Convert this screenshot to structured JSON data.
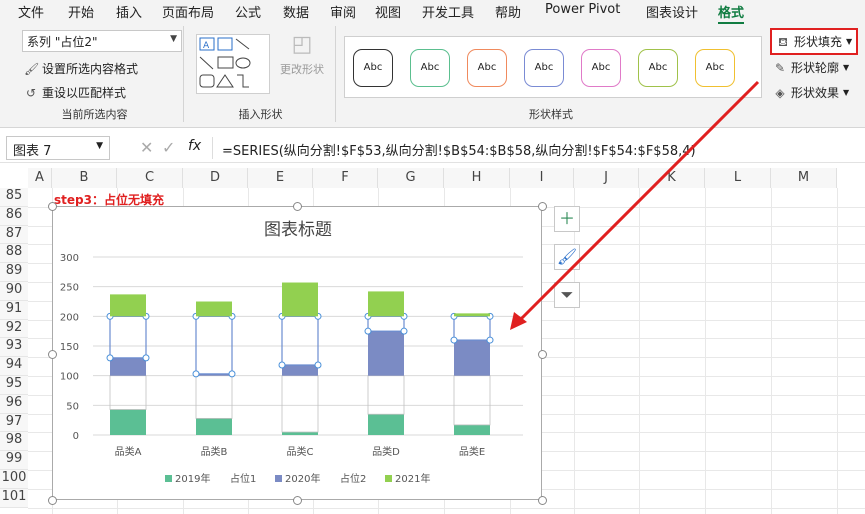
{
  "tabs": [
    "文件",
    "开始",
    "插入",
    "页面布局",
    "公式",
    "数据",
    "审阅",
    "视图",
    "开发工具",
    "帮助",
    "Power Pivot",
    "图表设计",
    "格式"
  ],
  "ribbon": {
    "current_selection": {
      "dropdown": "系列 \"占位2\"",
      "format_selection": "设置所选内容格式",
      "reset_style": "重设以匹配样式",
      "label": "当前所选内容"
    },
    "insert_shapes": {
      "change_shape": "更改形状",
      "label": "插入形状"
    },
    "shape_styles": {
      "abc": [
        "Abc",
        "Abc",
        "Abc",
        "Abc",
        "Abc",
        "Abc",
        "Abc"
      ],
      "colors": [
        "#333333",
        "#5bbf8f",
        "#f08a5d",
        "#7a8bd4",
        "#e07ac8",
        "#a0c24a",
        "#f0c030"
      ],
      "label": "形状样式"
    },
    "shape_fill": "形状填充",
    "shape_outline": "形状轮廓",
    "shape_effects": "形状效果"
  },
  "formula_bar": {
    "name_box": "图表 7",
    "fx": "fx",
    "formula": "=SERIES(纵向分割!$F$53,纵向分割!$B$54:$B$58,纵向分割!$F$54:$F$58,4)"
  },
  "columns": [
    "A",
    "B",
    "C",
    "D",
    "E",
    "F",
    "G",
    "H",
    "I",
    "J",
    "K",
    "L",
    "M"
  ],
  "rows": [
    "85",
    "86",
    "87",
    "88",
    "89",
    "90",
    "91",
    "92",
    "93",
    "94",
    "95",
    "96",
    "97",
    "98",
    "99",
    "100",
    "101"
  ],
  "step_note": "step3：占位无填充",
  "chart_data": {
    "type": "bar",
    "title": "图表标题",
    "categories": [
      "品类A",
      "品类B",
      "品类C",
      "品类D",
      "品类E"
    ],
    "ylim": [
      0,
      300
    ],
    "yticks": [
      "0",
      "50",
      "100",
      "150",
      "200",
      "250",
      "300"
    ],
    "series": [
      {
        "name": "2019年",
        "color": "#5bbf94",
        "values": [
          43,
          28,
          5,
          35,
          17
        ]
      },
      {
        "name": "占位1",
        "color": "none",
        "values": [
          57,
          72,
          95,
          65,
          83
        ]
      },
      {
        "name": "2020年",
        "color": "#7b8bc4",
        "values": [
          30,
          3,
          18,
          75,
          60
        ]
      },
      {
        "name": "占位2",
        "color": "none",
        "values": [
          70,
          97,
          82,
          25,
          40
        ]
      },
      {
        "name": "2021年",
        "color": "#92d050",
        "values": [
          37,
          25,
          57,
          42,
          5
        ]
      }
    ]
  }
}
